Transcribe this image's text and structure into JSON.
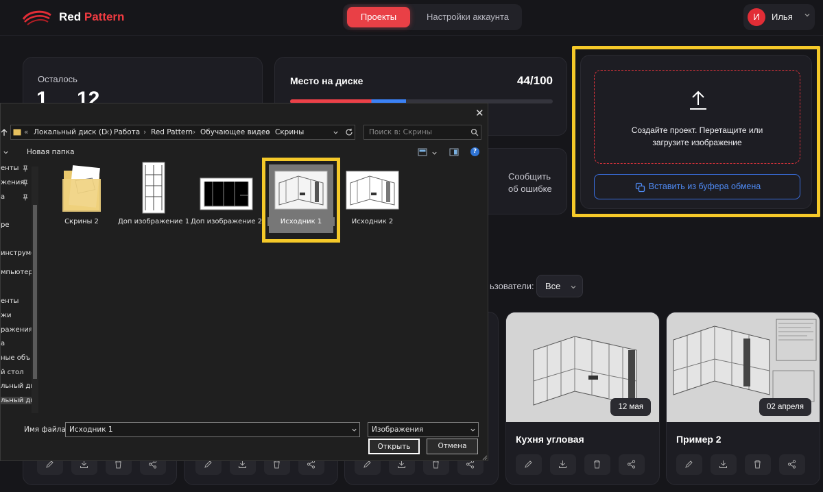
{
  "header": {
    "brand_first": "Red",
    "brand_second": "Pattern",
    "tabs": [
      {
        "label": "Проекты",
        "active": true
      },
      {
        "label": "Настройки аккаунта",
        "active": false
      }
    ],
    "user": {
      "initial": "И",
      "name": "Илья"
    }
  },
  "stats": {
    "remaining_label": "Осталось",
    "remaining_value": "1",
    "remaining_count": "12",
    "disk_label": "Место на диске",
    "disk_value": "44/100",
    "disk_fill_percent": 44,
    "report_line1": "Сообщить",
    "report_line2": "об ошибке"
  },
  "upload": {
    "line1": "Создайте проект. Перетащите или",
    "line2": "загрузите изображение",
    "paste_label": "Вставить из буфера обмена"
  },
  "filter": {
    "label": "ьзователи:",
    "value": "Все"
  },
  "projects": [
    {
      "title": "Кухня угловая",
      "date": "12 мая"
    },
    {
      "title": "Пример 2",
      "date": "02 апреля"
    }
  ],
  "dialog": {
    "breadcrumbs": [
      "Локальный диск (D:)",
      "Работа",
      "Red Pattern",
      "Обучающее видео",
      "Скрины"
    ],
    "search_placeholder": "Поиск в: Скрины",
    "new_folder": "Новая папка",
    "sidebar": [
      "енты",
      "жения",
      "а",
      "ре",
      "инструме",
      "мпьютер",
      "енты",
      "жи",
      "ражения",
      "а",
      "ные объ",
      "й стол",
      "льный дис",
      "льный дис"
    ],
    "files": [
      {
        "name": "Скрины 2"
      },
      {
        "name": "Доп изображение 1"
      },
      {
        "name": "Доп изображение 2"
      },
      {
        "name": "Исходник 1",
        "selected": true
      },
      {
        "name": "Исходник 2"
      }
    ],
    "filename_label": "Имя файла:",
    "filename_value": "Исходник 1",
    "filetype": "Изображения",
    "open_label": "Открыть",
    "cancel_label": "Отмена"
  },
  "colors": {
    "accent": "#e94046",
    "highlight": "#f5c929",
    "link": "#4f8bf5",
    "background": "#16161a"
  }
}
